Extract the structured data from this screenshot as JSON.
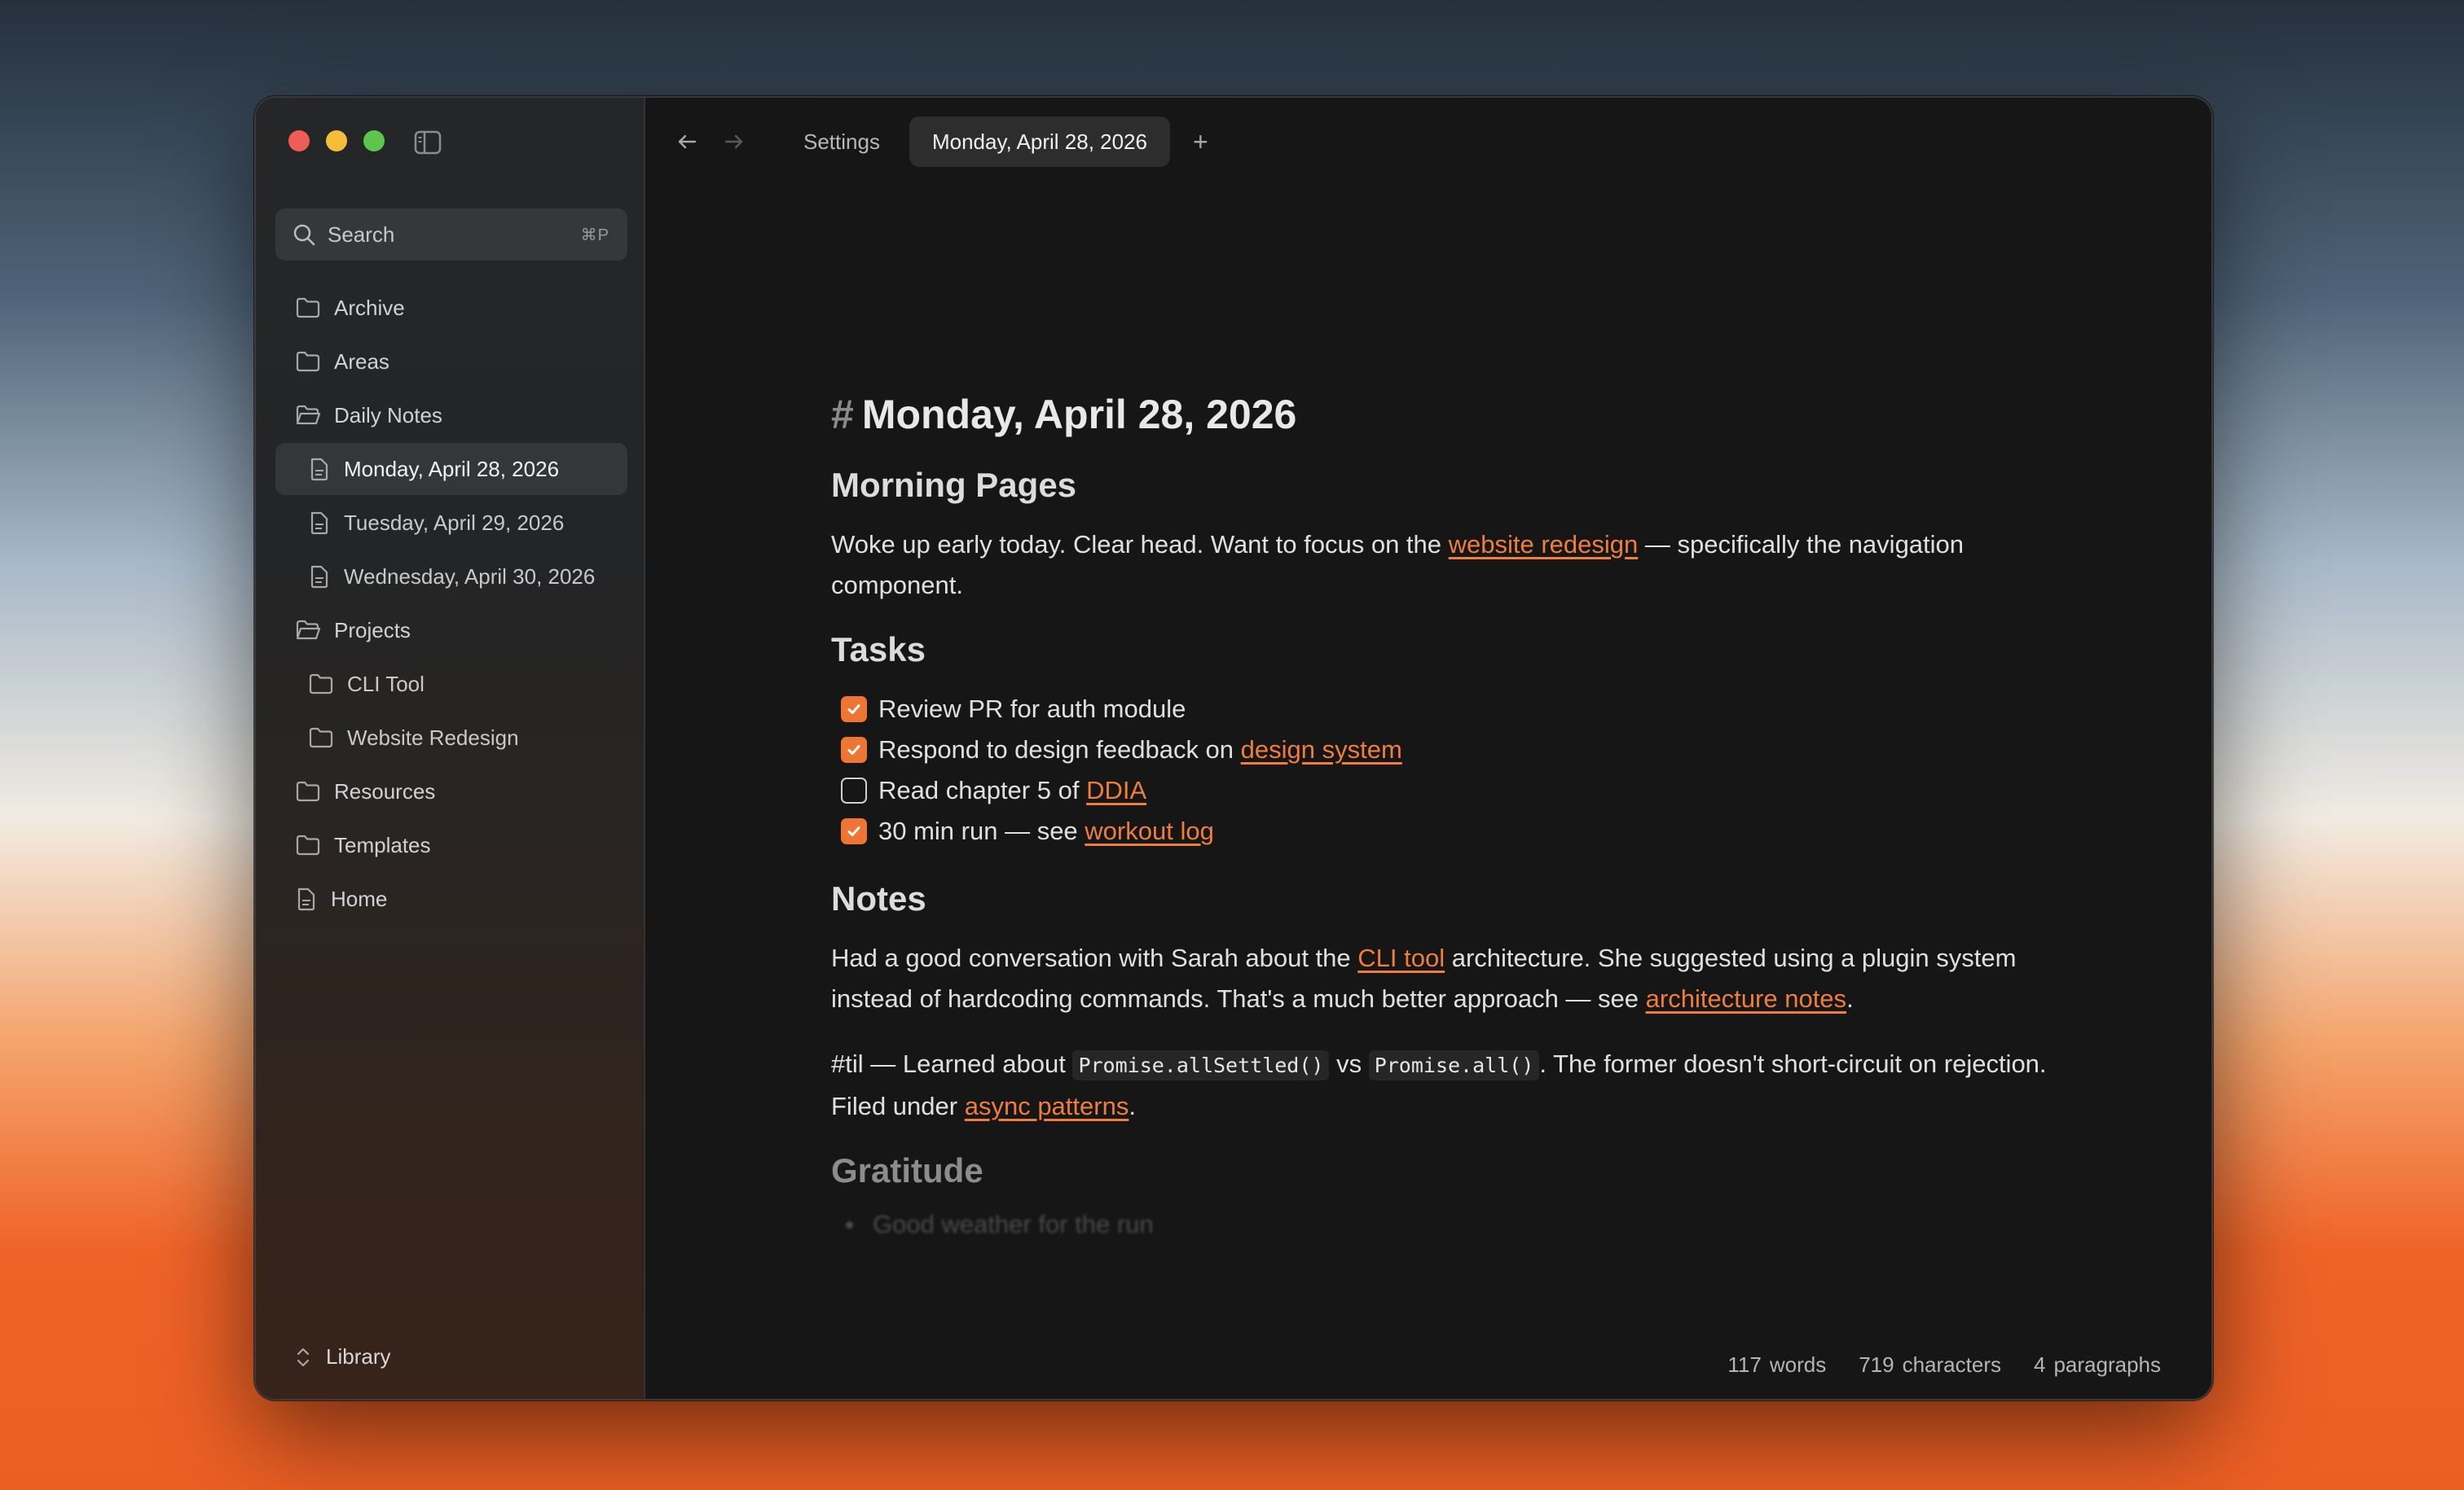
{
  "sidebar": {
    "search": {
      "label": "Search",
      "shortcut": "⌘P"
    },
    "items": [
      {
        "label": "Archive",
        "icon": "folder-icon"
      },
      {
        "label": "Areas",
        "icon": "folder-icon"
      },
      {
        "label": "Daily Notes",
        "icon": "folder-open-icon"
      },
      {
        "label": "Monday, April 28, 2026",
        "icon": "file-icon"
      },
      {
        "label": "Tuesday, April 29, 2026",
        "icon": "file-icon"
      },
      {
        "label": "Wednesday, April 30, 2026",
        "icon": "file-icon"
      },
      {
        "label": "Projects",
        "icon": "folder-open-icon"
      },
      {
        "label": "CLI Tool",
        "icon": "folder-icon"
      },
      {
        "label": "Website Redesign",
        "icon": "folder-icon"
      },
      {
        "label": "Resources",
        "icon": "folder-icon"
      },
      {
        "label": "Templates",
        "icon": "folder-icon"
      },
      {
        "label": "Home",
        "icon": "file-icon"
      }
    ],
    "library_label": "Library"
  },
  "tabs": [
    {
      "label": "Settings"
    },
    {
      "label": "Monday, April 28, 2026"
    }
  ],
  "tab_add": "+",
  "doc": {
    "hash": "#",
    "title": "Monday, April 28, 2026",
    "morning_heading": "Morning Pages",
    "morning": {
      "t1": "Woke up early today. Clear head. Want to focus on the ",
      "link1": "website redesign",
      "t2": " — specifically the navigation component."
    },
    "tasks_heading": "Tasks",
    "tasks": [
      {
        "text": "Review PR for auth module",
        "link": "",
        "checked": true
      },
      {
        "text": "Respond to design feedback on ",
        "link": "design system",
        "checked": true
      },
      {
        "text": "Read chapter 5 of ",
        "link": "DDIA",
        "checked": false
      },
      {
        "text": "30 min run — see ",
        "link": "workout log",
        "checked": true
      }
    ],
    "notes_heading": "Notes",
    "notes1": {
      "t1": "Had a good conversation with Sarah about the ",
      "link1": "CLI tool",
      "t2": " architecture. She suggested using a plugin system instead of hardcoding commands. That's a much better approach — see ",
      "link2": "architecture notes",
      "t3": "."
    },
    "notes2": {
      "t1": "#til — Learned about ",
      "code1": "Promise.allSettled()",
      "t2": " vs ",
      "code2": "Promise.all()",
      "t3": ". The former doesn't short-circuit on rejection. Filed under ",
      "link1": "async patterns",
      "t4": "."
    },
    "gratitude_heading": "Gratitude",
    "gratitude_item": "Good weather for the run"
  },
  "status": {
    "words_n": "117",
    "words_label": "words",
    "chars_n": "719",
    "chars_label": "characters",
    "paras_n": "4",
    "paras_label": "paragraphs"
  },
  "colors": {
    "accent": "#ef7632",
    "link": "#ef7d3c",
    "window_bg": "#161616"
  }
}
